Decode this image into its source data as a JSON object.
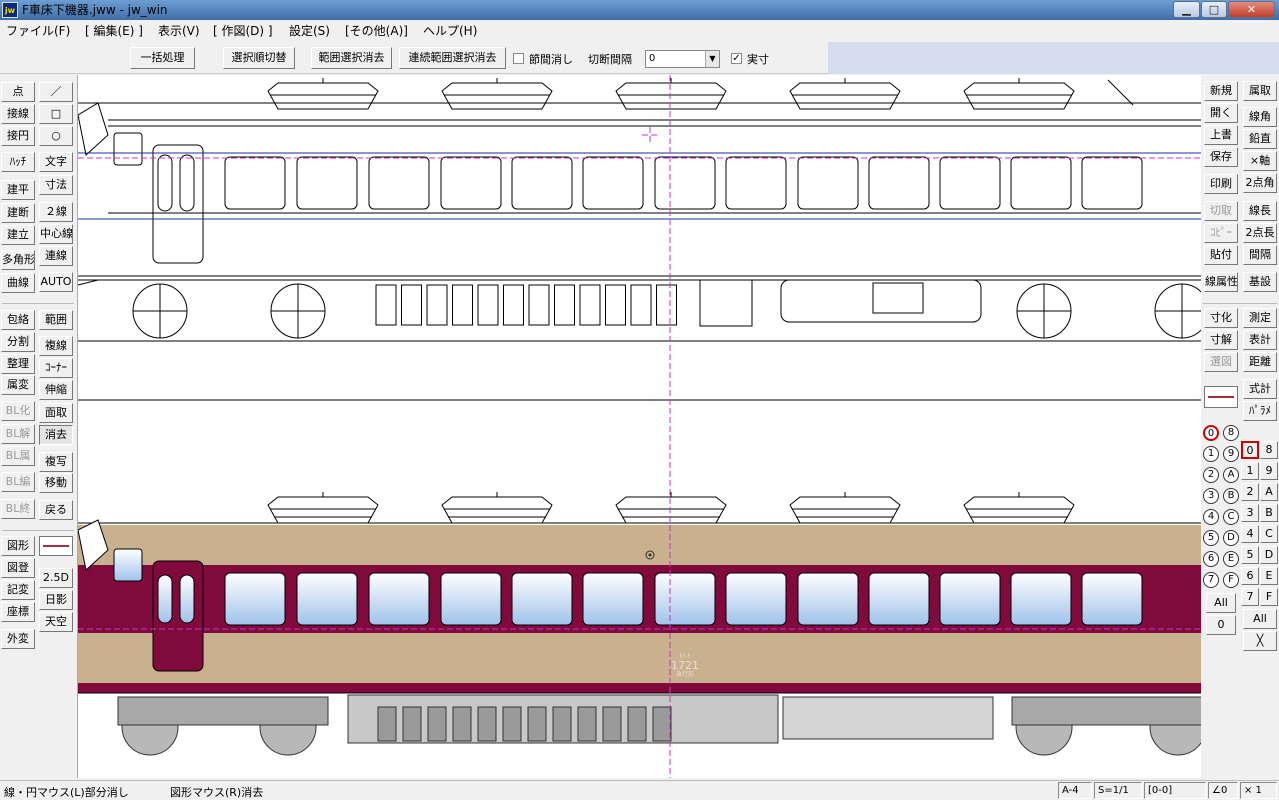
{
  "window": {
    "title": "F車床下機器.jww - jw_win",
    "app_icon": "jw",
    "minimize": "▁",
    "maximize": "□",
    "close": "✕"
  },
  "menu": [
    "ファイル(F)",
    "[ 編集(E) ]",
    "表示(V)",
    "[ 作図(D) ]",
    "設定(S)",
    "[その他(A)]",
    "ヘルプ(H)"
  ],
  "toolbar": {
    "batch": "一括処理",
    "order_switch": "選択順切替",
    "range_clear": "範囲選択消去",
    "continuous_clear": "連続範囲選択消去",
    "section_erase_label": "節間消し",
    "section_erase_checked": false,
    "cut_interval_label": "切断間隔",
    "cut_interval_value": "0",
    "actual_size_label": "実寸",
    "actual_size_checked": true
  },
  "left_palette": {
    "col1": [
      {
        "label": "点",
        "enabled": true
      },
      {
        "label": "接線",
        "enabled": true
      },
      {
        "label": "接円",
        "enabled": true
      },
      {
        "label": "ﾊｯﾁ",
        "enabled": true
      },
      {
        "label": "建平",
        "enabled": true
      },
      {
        "label": "建断",
        "enabled": true
      },
      {
        "label": "建立",
        "enabled": true
      },
      {
        "label": "多角形",
        "enabled": true
      },
      {
        "label": "曲線",
        "enabled": true
      },
      {
        "label": "包絡",
        "enabled": true
      },
      {
        "label": "分割",
        "enabled": true
      },
      {
        "label": "整理",
        "enabled": true
      },
      {
        "label": "属変",
        "enabled": true
      },
      {
        "label": "BL化",
        "enabled": false
      },
      {
        "label": "BL解",
        "enabled": false
      },
      {
        "label": "BL属",
        "enabled": false
      },
      {
        "label": "BL編",
        "enabled": false
      },
      {
        "label": "BL終",
        "enabled": false
      },
      {
        "label": "図形",
        "enabled": true
      },
      {
        "label": "図登",
        "enabled": true
      },
      {
        "label": "記変",
        "enabled": true
      },
      {
        "label": "座標",
        "enabled": true
      },
      {
        "label": "外変",
        "enabled": true
      }
    ],
    "col2": [
      {
        "label": "／",
        "enabled": true
      },
      {
        "label": "□",
        "enabled": true
      },
      {
        "label": "○",
        "enabled": true
      },
      {
        "label": "文字",
        "enabled": true
      },
      {
        "label": "寸法",
        "enabled": true
      },
      {
        "label": "２線",
        "enabled": true
      },
      {
        "label": "中心線",
        "enabled": true
      },
      {
        "label": "連線",
        "enabled": true
      },
      {
        "label": "AUTO",
        "enabled": true
      },
      {
        "label": "範囲",
        "enabled": true
      },
      {
        "label": "複線",
        "enabled": true
      },
      {
        "label": "ｺｰﾅｰ",
        "enabled": true
      },
      {
        "label": "伸縮",
        "enabled": true
      },
      {
        "label": "面取",
        "enabled": true
      },
      {
        "label": "消去",
        "enabled": true
      },
      {
        "label": "複写",
        "enabled": true
      },
      {
        "label": "移動",
        "enabled": true
      },
      {
        "label": "戻る",
        "enabled": true
      },
      {
        "label": "",
        "enabled": true
      },
      {
        "label": "2.5D",
        "enabled": true
      },
      {
        "label": "日影",
        "enabled": true
      },
      {
        "label": "天空",
        "enabled": true
      }
    ]
  },
  "right_palette": {
    "col1": [
      {
        "label": "新規",
        "enabled": true
      },
      {
        "label": "開く",
        "enabled": true
      },
      {
        "label": "上書",
        "enabled": true
      },
      {
        "label": "保存",
        "enabled": true
      },
      {
        "label": "印刷",
        "enabled": true
      },
      {
        "label": "切取",
        "enabled": false
      },
      {
        "label": "ｺﾋﾟｰ",
        "enabled": false
      },
      {
        "label": "貼付",
        "enabled": true
      },
      {
        "label": "線属性",
        "enabled": true
      },
      {
        "label": "寸化",
        "enabled": true
      },
      {
        "label": "寸解",
        "enabled": true
      },
      {
        "label": "選図",
        "enabled": false
      }
    ],
    "col2": [
      {
        "label": "属取",
        "enabled": true
      },
      {
        "label": "線角",
        "enabled": true
      },
      {
        "label": "鉛直",
        "enabled": true
      },
      {
        "label": "×軸",
        "enabled": true
      },
      {
        "label": "2点角",
        "enabled": true
      },
      {
        "label": "線長",
        "enabled": true
      },
      {
        "label": "2点長",
        "enabled": true
      },
      {
        "label": "間隔",
        "enabled": true
      },
      {
        "label": "基設",
        "enabled": true
      },
      {
        "label": "測定",
        "enabled": true
      },
      {
        "label": "表計",
        "enabled": true
      },
      {
        "label": "距離",
        "enabled": true
      },
      {
        "label": "式計",
        "enabled": true
      },
      {
        "label": "ﾊﾟﾗﾒ",
        "enabled": true
      }
    ],
    "group_circles": [
      [
        "0",
        "8"
      ],
      [
        "1",
        "9"
      ],
      [
        "2",
        "A"
      ],
      [
        "3",
        "B"
      ],
      [
        "4",
        "C"
      ],
      [
        "5",
        "D"
      ],
      [
        "6",
        "E"
      ],
      [
        "7",
        "F"
      ]
    ],
    "group_all": "All",
    "group_current": "0",
    "layers": [
      [
        "0",
        "8"
      ],
      [
        "1",
        "9"
      ],
      [
        "2",
        "A"
      ],
      [
        "3",
        "B"
      ],
      [
        "4",
        "C"
      ],
      [
        "5",
        "D"
      ],
      [
        "6",
        "E"
      ],
      [
        "7",
        "F"
      ]
    ],
    "layer_all": "All",
    "layer_x": "╳"
  },
  "status": {
    "left_message": "線・円マウス(L)部分消し",
    "right_message": "図形マウス(R)消去",
    "paper": "A-4",
    "scale": "S=1/1",
    "layer": "[0-0]",
    "angle": "∠0",
    "zoom": "× 1"
  },
  "drawing": {
    "car_number": "1721",
    "car_number_small": "ﾓﾊ ﾓ",
    "car_number_sub": "急行形",
    "colors": {
      "maroon": "#800a3c",
      "beige": "#c9b08e",
      "window_top": "#ffffff",
      "window_bottom": "#9fc2ea",
      "center_line": "#cc33cc",
      "blue_line": "#1a2f9a"
    }
  }
}
